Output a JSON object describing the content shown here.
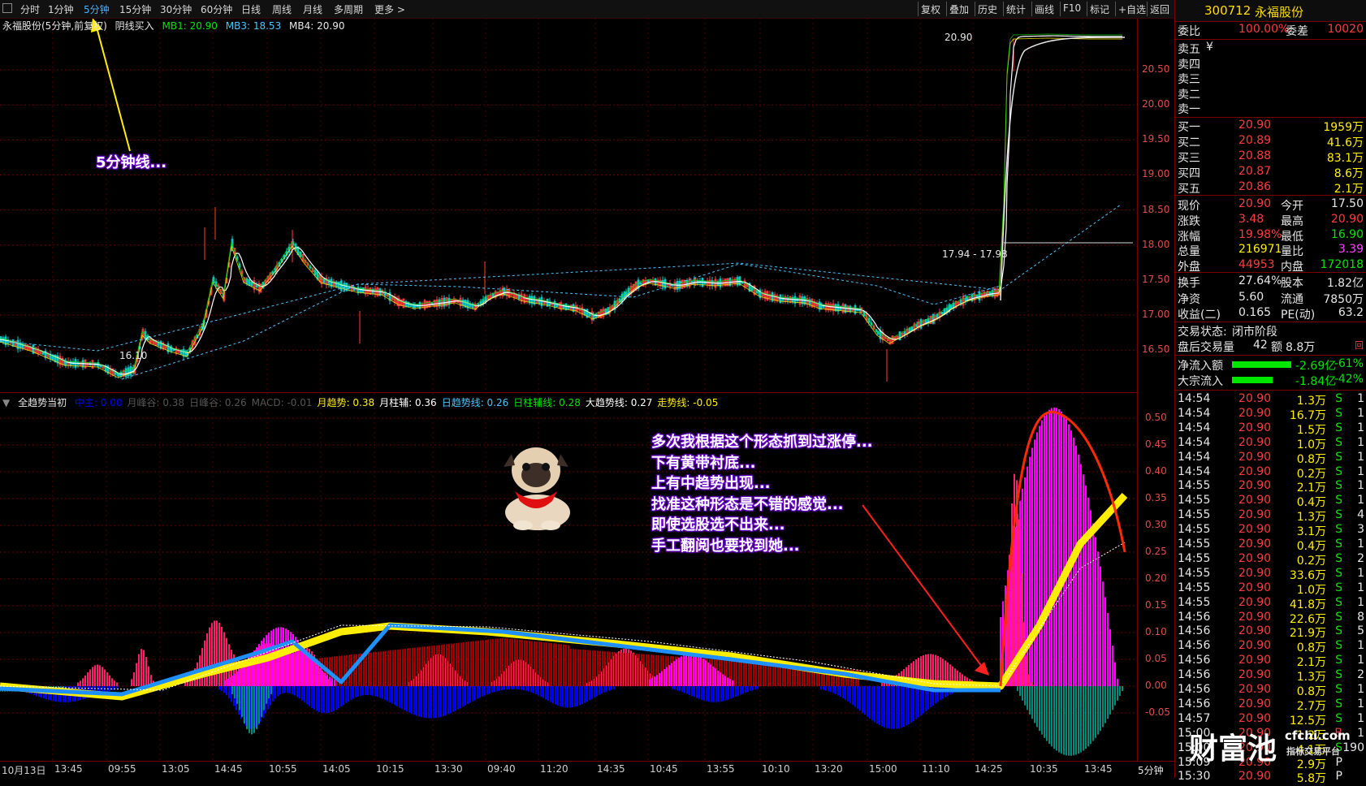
{
  "toolbar": {
    "periods": [
      "分时",
      "1分钟",
      "5分钟",
      "15分钟",
      "30分钟",
      "60分钟",
      "日线",
      "周线",
      "月线",
      "多周期",
      "更多 >"
    ],
    "active_period": "5分钟",
    "tools": [
      "复权",
      "叠加",
      "历史",
      "统计",
      "画线",
      "F10",
      "标记",
      "+自选",
      "返回"
    ]
  },
  "price_panel": {
    "title": "永福股份(5分钟,前复权)",
    "indicator": "阴线买入",
    "mb1_label": "MB1: 20.90",
    "mb3_label": "MB3: 18.53",
    "mb4_label": "MB4: 20.90",
    "y_ticks": [
      "20.50",
      "20.00",
      "19.50",
      "19.00",
      "18.50",
      "18.00",
      "17.50",
      "17.00",
      "16.50"
    ],
    "y_values": [
      20.5,
      20.0,
      19.5,
      19.0,
      18.5,
      18.0,
      17.5,
      17.0,
      16.5
    ],
    "low_label": "16.10",
    "high_label": "20.90",
    "range_label": "17.94 - 17.98",
    "annotation": "5分钟线..."
  },
  "indicator_panel": {
    "title": "全趋势当初",
    "legend": [
      {
        "text": "中主: 0.00",
        "color": "#0000ff"
      },
      {
        "text": "月峰谷: 0.38",
        "color": "#555555"
      },
      {
        "text": "日峰谷: 0.26",
        "color": "#555555"
      },
      {
        "text": "MACD: -0.01",
        "color": "#555555"
      },
      {
        "text": "月趋势: 0.38",
        "color": "#ffee00"
      },
      {
        "text": "月柱辅: 0.36",
        "color": "#ffffff"
      },
      {
        "text": "日趋势线: 0.26",
        "color": "#49c6ff"
      },
      {
        "text": "日柱辅线: 0.28",
        "color": "#00e600"
      },
      {
        "text": "大趋势线: 0.27",
        "color": "#ffffff"
      },
      {
        "text": "走势线: -0.05",
        "color": "#ffee00"
      }
    ],
    "y_ticks": [
      "0.50",
      "0.45",
      "0.40",
      "0.35",
      "0.30",
      "0.25",
      "0.20",
      "0.15",
      "0.10",
      "0.05",
      "0.00",
      "-0.05"
    ],
    "annotations": [
      "多次我根据这个形态抓到过涨停...",
      "下有黄带衬底...",
      "上有中趋势出现...",
      "找准这种形态是不错的感觉...",
      "即使选股选不出来...",
      "手工翻阅也要找到她..."
    ]
  },
  "x_axis": [
    "10月13日",
    "13:45",
    "09:55",
    "13:05",
    "14:45",
    "10:55",
    "14:05",
    "10:15",
    "13:30",
    "09:40",
    "11:20",
    "14:35",
    "10:45",
    "13:55",
    "10:10",
    "13:20",
    "15:00",
    "11:10",
    "14:25",
    "10:35",
    "13:45"
  ],
  "x_period": "5分钟",
  "quote": {
    "code": "300712",
    "name": "永福股份",
    "weibi_label": "委比",
    "weibi": "100.00%",
    "weicha_label": "委差",
    "weicha": "10020",
    "sell": [
      {
        "label": "卖五",
        "price": "¥",
        "vol": ""
      },
      {
        "label": "卖四",
        "price": "",
        "vol": ""
      },
      {
        "label": "卖三",
        "price": "",
        "vol": ""
      },
      {
        "label": "卖二",
        "price": "",
        "vol": ""
      },
      {
        "label": "卖一",
        "price": "",
        "vol": ""
      }
    ],
    "buy": [
      {
        "label": "买一",
        "price": "20.90",
        "vol": "1959万"
      },
      {
        "label": "买二",
        "price": "20.89",
        "vol": "41.6万"
      },
      {
        "label": "买三",
        "price": "20.88",
        "vol": "83.1万"
      },
      {
        "label": "买四",
        "price": "20.87",
        "vol": "8.6万"
      },
      {
        "label": "买五",
        "price": "20.86",
        "vol": "2.1万"
      }
    ],
    "stats": [
      {
        "l1": "现价",
        "v1": "20.90",
        "l2": "今开",
        "v2": "17.50"
      },
      {
        "l1": "涨跌",
        "v1": "3.48",
        "l2": "最高",
        "v2": "20.90"
      },
      {
        "l1": "涨幅",
        "v1": "19.98%",
        "l2": "最低",
        "v2": "16.90"
      },
      {
        "l1": "总量",
        "v1": "216971",
        "l2": "量比",
        "v2": "3.39"
      },
      {
        "l1": "外盘",
        "v1": "44953",
        "l2": "内盘",
        "v2": "172018"
      }
    ],
    "stats2": [
      {
        "l1": "换手",
        "v1": "27.64%",
        "l2": "股本",
        "v2": "1.82亿"
      },
      {
        "l1": "净资",
        "v1": "5.60",
        "l2": "流通",
        "v2": "7850万"
      },
      {
        "l1": "收益(二)",
        "v1": "0.165",
        "l2": "PE(动)",
        "v2": "63.2"
      }
    ],
    "status_label": "交易状态:",
    "status_value": "闭市阶段",
    "after_label": "盘后交易量",
    "after_vol": "42",
    "after_amt_label": "额",
    "after_amt": "8.8万",
    "after_badge": "回",
    "netflow": [
      {
        "label": "净流入额",
        "value": "-2.69亿",
        "pct": "-61%",
        "bar": 0.61
      },
      {
        "label": "大宗流入",
        "value": "-1.84亿",
        "pct": "-42%",
        "bar": 0.42
      }
    ]
  },
  "trades": [
    {
      "t": "14:54",
      "p": "20.90",
      "v": "1.3万",
      "s": "S",
      "n": "1"
    },
    {
      "t": "14:54",
      "p": "20.90",
      "v": "16.7万",
      "s": "S",
      "n": "1"
    },
    {
      "t": "14:54",
      "p": "20.90",
      "v": "1.5万",
      "s": "S",
      "n": "1"
    },
    {
      "t": "14:54",
      "p": "20.90",
      "v": "1.0万",
      "s": "S",
      "n": "1"
    },
    {
      "t": "14:54",
      "p": "20.90",
      "v": "0.8万",
      "s": "S",
      "n": "1"
    },
    {
      "t": "14:54",
      "p": "20.90",
      "v": "0.2万",
      "s": "S",
      "n": "1"
    },
    {
      "t": "14:55",
      "p": "20.90",
      "v": "2.1万",
      "s": "S",
      "n": "1"
    },
    {
      "t": "14:55",
      "p": "20.90",
      "v": "0.4万",
      "s": "S",
      "n": "1"
    },
    {
      "t": "14:55",
      "p": "20.90",
      "v": "1.3万",
      "s": "S",
      "n": "4"
    },
    {
      "t": "14:55",
      "p": "20.90",
      "v": "3.1万",
      "s": "S",
      "n": "3"
    },
    {
      "t": "14:55",
      "p": "20.90",
      "v": "0.4万",
      "s": "S",
      "n": "1"
    },
    {
      "t": "14:55",
      "p": "20.90",
      "v": "0.2万",
      "s": "S",
      "n": "2"
    },
    {
      "t": "14:55",
      "p": "20.90",
      "v": "33.6万",
      "s": "S",
      "n": "1"
    },
    {
      "t": "14:55",
      "p": "20.90",
      "v": "1.0万",
      "s": "S",
      "n": "1"
    },
    {
      "t": "14:55",
      "p": "20.90",
      "v": "41.8万",
      "s": "S",
      "n": "1"
    },
    {
      "t": "14:56",
      "p": "20.90",
      "v": "22.6万",
      "s": "S",
      "n": "8"
    },
    {
      "t": "14:56",
      "p": "20.90",
      "v": "21.9万",
      "s": "S",
      "n": "5"
    },
    {
      "t": "14:56",
      "p": "20.90",
      "v": "0.8万",
      "s": "S",
      "n": "1"
    },
    {
      "t": "14:56",
      "p": "20.90",
      "v": "2.1万",
      "s": "S",
      "n": "1"
    },
    {
      "t": "14:56",
      "p": "20.90",
      "v": "1.3万",
      "s": "S",
      "n": "2"
    },
    {
      "t": "14:56",
      "p": "20.90",
      "v": "0.8万",
      "s": "S",
      "n": "1"
    },
    {
      "t": "14:56",
      "p": "20.90",
      "v": "2.7万",
      "s": "S",
      "n": "1"
    },
    {
      "t": "14:57",
      "p": "20.90",
      "v": "12.5万",
      "s": "S",
      "n": "1"
    },
    {
      "t": "15:00",
      "p": "20.90",
      "v": "1.2万",
      "s": "B",
      "n": "1"
    },
    {
      "t": "15:00",
      "p": "20.90",
      "v": "4.1万",
      "s": "S",
      "n": "190"
    },
    {
      "t": "15:09",
      "p": "20.90",
      "v": "2.9万",
      "s": "P",
      "n": ""
    },
    {
      "t": "15:30",
      "p": "20.90",
      "v": "5.8万",
      "s": "P",
      "n": ""
    }
  ],
  "watermark": {
    "brand": "财富池",
    "site": "cfchi.com",
    "sub": "指标交易平台"
  },
  "colors": {
    "up": "#ff3b3b",
    "down": "#00e600",
    "accent": "#ffee00",
    "border": "#7a0000",
    "band_yellow": "#ffee00",
    "magenta": "#ff00ff",
    "blue": "#0000ff",
    "teal": "#008b7a"
  }
}
